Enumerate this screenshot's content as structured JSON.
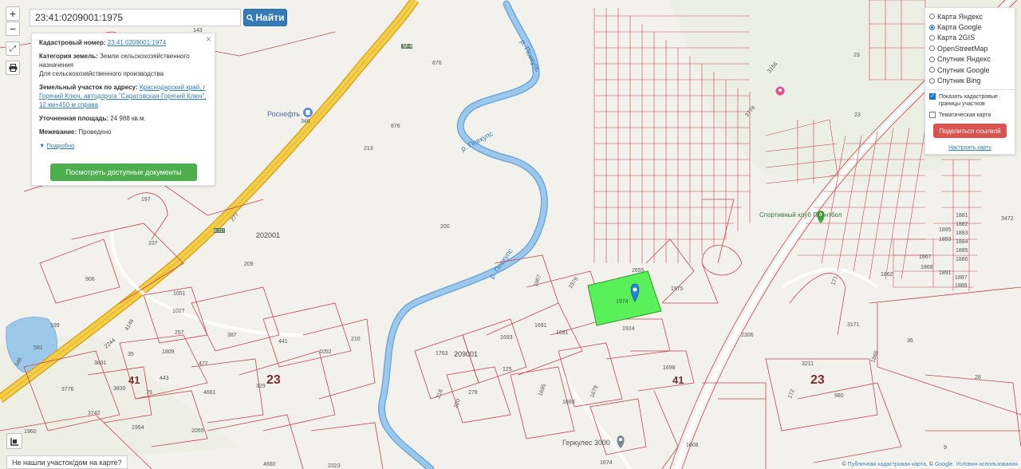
{
  "search": {
    "value": "23:41:0209001:1975",
    "button_label": "Найти"
  },
  "controls": {
    "zoom_in": "+",
    "zoom_out": "−"
  },
  "info": {
    "cad_label": "Кадастровый номер:",
    "cad_value": "23:41:0209001:1974",
    "category_label": "Категория земель:",
    "category_value": "Земли сельскохозяйственного назначения",
    "usage_value": "Для сельскохозяйственного производства",
    "address_label": "Земельный участок по адресу:",
    "address_value": "Краснодарский край, г Горячий Ключ, автодорога \"Саратовская-Горячий Ключ\", 12 км+450 м справа",
    "area_label": "Уточненная площадь:",
    "area_value": "24 988 кв.м.",
    "survey_label": "Межевание:",
    "survey_value": "Проведено",
    "details_link": "Подробно",
    "docs_button": "Посмотреть доступные документы",
    "close": "×"
  },
  "layers": {
    "options": [
      {
        "label": "Карта Яндекс",
        "selected": false
      },
      {
        "label": "Карта Google",
        "selected": true
      },
      {
        "label": "Карта 2GIS",
        "selected": false
      },
      {
        "label": "OpenStreetMap",
        "selected": false
      },
      {
        "label": "Спутник Яндекс",
        "selected": false
      },
      {
        "label": "Спутник Google",
        "selected": false
      },
      {
        "label": "Спутник Bing",
        "selected": false
      }
    ],
    "show_borders": "Показать кадастровые границы участков",
    "thematic": "Тематическая карта",
    "share": "Поделиться ссылкой",
    "setup": "Настроить карту"
  },
  "bottom": {
    "not_found": "Не нашли участок/дом на карте?",
    "attribution_prefix": "© ",
    "attribution_pkk": "Публичная кадастровая карта",
    "attribution_sep": ", © ",
    "attribution_google": "Google",
    "attribution_terms": ". Условия использования"
  },
  "map_labels": {
    "district_202001": "202001",
    "district_209001": "209001",
    "big_23_a": "23",
    "big_23_b": "23",
    "big_41_a": "41",
    "big_41_b": "41",
    "river_1": "р. Псекупс",
    "river_2": "р. Псекупс",
    "river_3": "р. Псекупс",
    "poi_rosneft": "Роснефть",
    "poi_hercules": "Геркулес 3000",
    "poi_paintball": "Спортивный клуб Пейнтбол",
    "highway": "М-4",
    "highway_2": "R-217",
    "parcel_selected": "1974",
    "p876": "876",
    "p876b": "876",
    "p213": "213",
    "p200": "200",
    "p237": "237",
    "p197": "197",
    "p209": "209",
    "p906": "906",
    "p1051": "1051",
    "p1027": "1027",
    "p257": "257",
    "p387": "387",
    "p441": "441",
    "p1052": "1052",
    "p210": "210",
    "p581": "581",
    "p199": "199",
    "p35": "35",
    "p1809": "1809",
    "p443": "443",
    "p79": "79",
    "p3776": "3776",
    "p3830": "3830",
    "p3742": "3742",
    "p1954": "1954",
    "p2055": "2055",
    "p1960": "1960",
    "p4660": "4660",
    "p2323": "2323",
    "p329": "329",
    "p4661": "4661",
    "p477": "477",
    "p3831": "3831",
    "p1763": "1763",
    "p1693": "1693",
    "p1691": "1691",
    "p1691b": "1691",
    "p1693b": "1693",
    "p279": "279",
    "p125": "125",
    "p1924": "1924",
    "p1975": "1975",
    "p1698": "1698",
    "p1674": "1674",
    "p1608": "1608",
    "p2306": "2306",
    "p3171": "3171",
    "p36": "36",
    "p3211": "3211",
    "p980": "980",
    "p28": "28",
    "p9": "9",
    "p3472": "3472",
    "p23tr": "23",
    "p23b": "23",
    "p143": "143",
    "p348": "348",
    "p2655": "2655",
    "p1976": "1976",
    "p1887": "1887",
    "p1889": "1889",
    "p1862": "1862",
    "p1867": "1867",
    "p1868": "1868",
    "p1886": "1886",
    "p1885": "1885",
    "p1884": "1884",
    "p1883": "1883",
    "p1882": "1882",
    "p1881": "1881",
    "p1893": "1893",
    "p1891": "1891",
    "p1895": "1895",
    "p277": "277",
    "p3166": "3166",
    "p3778": "3778",
    "p218": "218",
    "p220": "220",
    "p1679": "1679",
    "p1695": "1695",
    "p1967": "1967",
    "p2244": "2244",
    "p4146": "4146",
    "p346": "346",
    "p171": "171",
    "p172": "172",
    "p1866": "1866"
  },
  "colors": {
    "parcel_line": "#c8464b",
    "river": "#7fb6dd",
    "road": "#f2c230",
    "selected_parcel": "#59f059",
    "marker": "#2e7fd6"
  }
}
